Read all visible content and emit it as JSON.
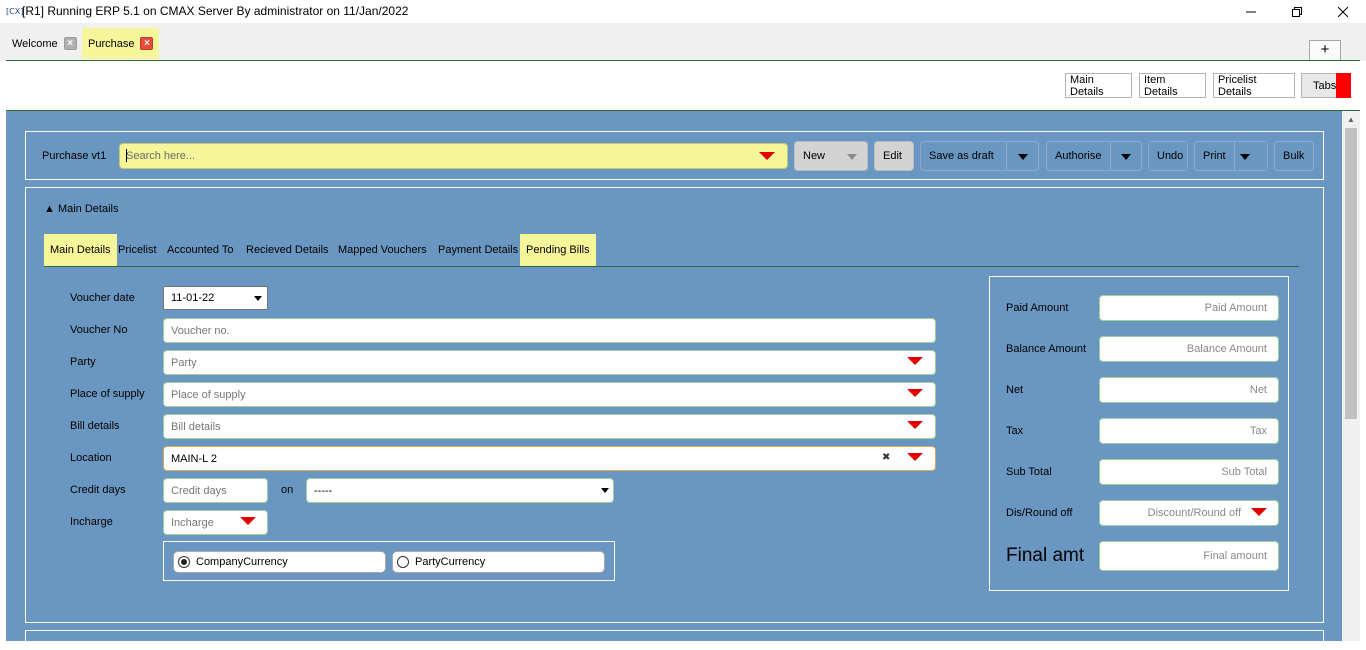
{
  "window": {
    "title": "[R1] Running ERP 5.1 on CMAX Server By administrator on 11/Jan/2022",
    "app_icon": "[CX]",
    "minimize": "—",
    "maximize": "❐",
    "close": "✕"
  },
  "doc_tabs": [
    {
      "label": "Welcome",
      "close": "×"
    },
    {
      "label": "Purchase",
      "close": "×"
    }
  ],
  "add_tab": "+",
  "header_buttons": {
    "main_details": "Main Details",
    "item_details": "Item Details",
    "pricelist_details": "Pricelist Details",
    "tabs": "Tabs"
  },
  "toolbar": {
    "voucher_type": "Purchase vt1",
    "search_placeholder": "Search here...",
    "new": "New",
    "edit": "Edit",
    "save_as_draft": "Save as draft",
    "authorise": "Authorise",
    "undo": "Undo",
    "print": "Print",
    "bulk": "Bulk"
  },
  "section": {
    "toggle": "▲ Main Details"
  },
  "sub_tabs": [
    {
      "label": "Main Details",
      "active": true
    },
    {
      "label": "Pricelist",
      "active": false
    },
    {
      "label": "Accounted To",
      "active": false
    },
    {
      "label": "Recieved Details",
      "active": false
    },
    {
      "label": "Mapped Vouchers",
      "active": false
    },
    {
      "label": "Payment Details",
      "active": false
    },
    {
      "label": "Pending Bills",
      "active": true
    }
  ],
  "form": {
    "voucher_date": {
      "label": "Voucher date",
      "value": "11-01-22"
    },
    "voucher_no": {
      "label": "Voucher No",
      "placeholder": "Voucher no."
    },
    "party": {
      "label": "Party",
      "placeholder": "Party"
    },
    "place_of_supply": {
      "label": "Place of supply",
      "placeholder": "Place of supply"
    },
    "bill_details": {
      "label": "Bill details",
      "placeholder": "Bill details"
    },
    "location": {
      "label": "Location",
      "value": "MAIN-L 2",
      "clear": "✖"
    },
    "credit_days": {
      "label": "Credit days",
      "placeholder": "Credit days",
      "on_label": "on",
      "on_value": "-----"
    },
    "incharge": {
      "label": "Incharge",
      "placeholder": "Incharge"
    },
    "currency": {
      "company": {
        "label": "CompanyCurrency",
        "checked": true
      },
      "party": {
        "label": "PartyCurrency",
        "checked": false
      }
    }
  },
  "totals": {
    "paid_amount": {
      "label": "Paid Amount",
      "placeholder": "Paid Amount"
    },
    "balance_amount": {
      "label": "Balance Amount",
      "placeholder": "Balance Amount"
    },
    "net": {
      "label": "Net",
      "placeholder": "Net"
    },
    "tax": {
      "label": "Tax",
      "placeholder": "Tax"
    },
    "sub_total": {
      "label": "Sub Total",
      "placeholder": "Sub Total"
    },
    "dis_round_off": {
      "label": "Dis/Round off",
      "placeholder": "Discount/Round off"
    },
    "final_amt": {
      "label": "Final amt",
      "placeholder": "Final amount"
    }
  },
  "colors": {
    "panel_bg": "#6a97c1",
    "highlight": "#f5f59a",
    "accent_red": "#e00000",
    "divider_green": "#2e6b38"
  }
}
